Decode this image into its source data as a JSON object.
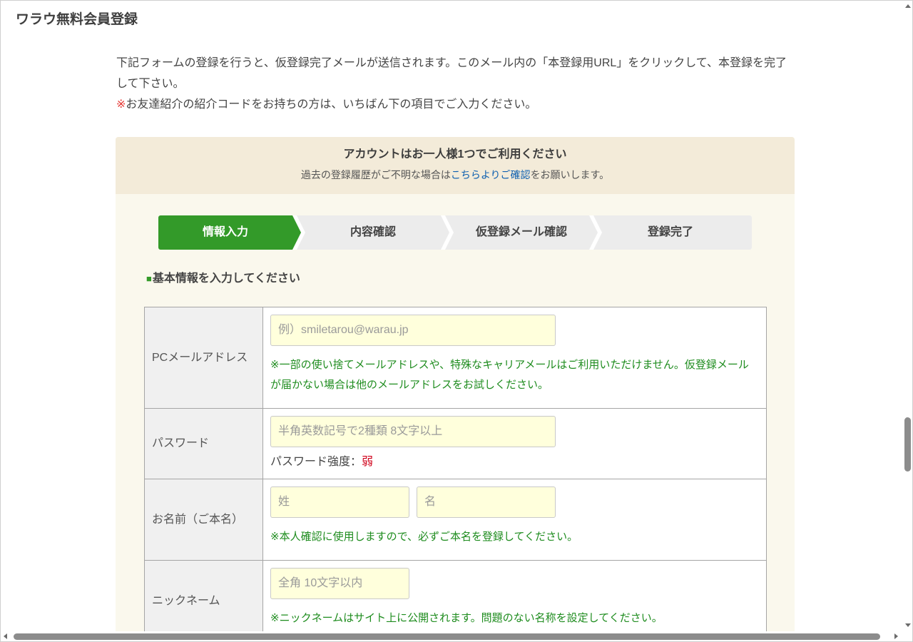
{
  "page": {
    "title": "ワラウ無料会員登録"
  },
  "intro": {
    "text": "下記フォームの登録を行うと、仮登録完了メールが送信されます。このメール内の「本登録用URL」をクリックして、本登録を完了して下さい。",
    "note_mark": "※",
    "note_text": "お友達紹介の紹介コードをお持ちの方は、いちばん下の項目でご入力ください。"
  },
  "notice": {
    "title": "アカウントはお一人様1つでご利用ください",
    "text_before": "過去の登録履歴がご不明な場合は",
    "link": "こちらよりご確認",
    "text_after": "をお願いします。"
  },
  "steps": [
    {
      "label": "情報入力",
      "active": true
    },
    {
      "label": "内容確認",
      "active": false
    },
    {
      "label": "仮登録メール確認",
      "active": false
    },
    {
      "label": "登録完了",
      "active": false
    }
  ],
  "section": {
    "marker": "■",
    "heading": "基本情報を入力してください"
  },
  "form": {
    "email": {
      "label": "PCメールアドレス",
      "value": "",
      "placeholder": "例）smiletarou@warau.jp",
      "note": "※一部の使い捨てメールアドレスや、特殊なキャリアメールはご利用いただけません。仮登録メールが届かない場合は他のメールアドレスをお試しください。"
    },
    "password": {
      "label": "パスワード",
      "value": "",
      "placeholder": "半角英数記号で2種類 8文字以上",
      "strength_label": "パスワード強度：",
      "strength_value": "弱"
    },
    "name": {
      "label": "お名前（ご本名）",
      "last_value": "",
      "last_placeholder": "姓",
      "first_value": "",
      "first_placeholder": "名",
      "note": "※本人確認に使用しますので、必ずご本名を登録してください。"
    },
    "nickname": {
      "label": "ニックネーム",
      "value": "",
      "placeholder": "全角 10文字以内",
      "note": "※ニックネームはサイト上に公開されます。問題のない名称を設定してください。"
    }
  },
  "colors": {
    "accent": "#339a29",
    "link": "#0d5fb0",
    "alert": "#e53935",
    "note": "#1e8c1e",
    "input_bg": "#ffffdc",
    "notice_bg": "#f3ebd9",
    "panel_bg": "#faf8ed",
    "step_bg": "#ececec"
  }
}
